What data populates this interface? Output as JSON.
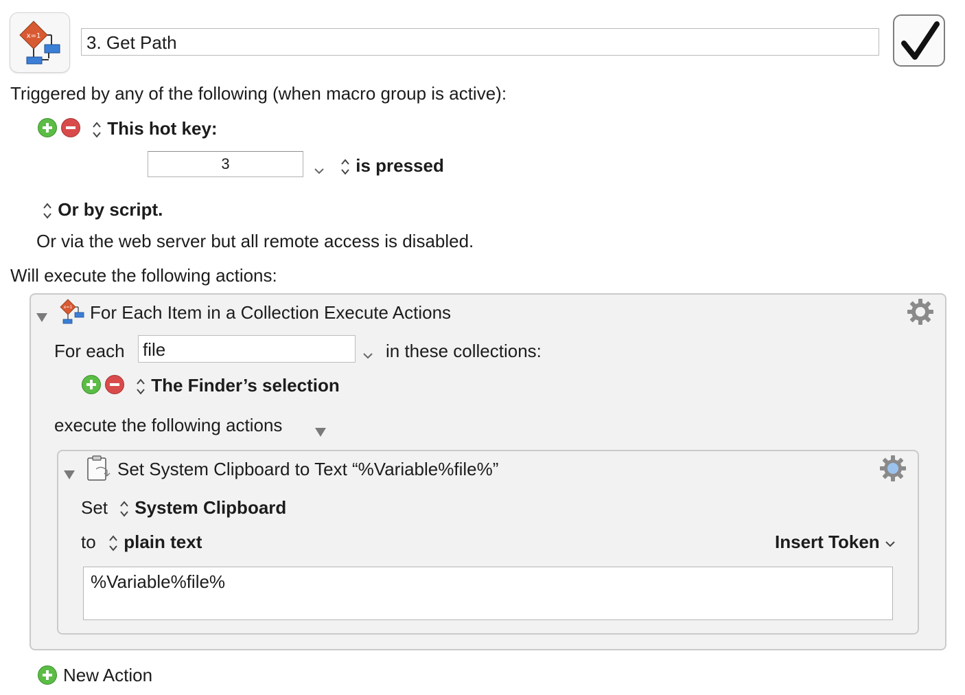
{
  "macro": {
    "name": "3. Get Path",
    "enabled": true
  },
  "triggers": {
    "heading": "Triggered by any of the following (when macro group is active):",
    "hotkey_label": "This hot key:",
    "hotkey_value": "3",
    "hotkey_condition": "is pressed",
    "script_label": "Or by script.",
    "web_server_note": "Or via the web server but all remote access is disabled."
  },
  "actions_heading": "Will execute the following actions:",
  "for_each_action": {
    "title": "For Each Item in a Collection Execute Actions",
    "for_each_label": "For each",
    "variable": "file",
    "collections_label": "in these collections:",
    "collection": "The Finder’s selection",
    "execute_label": "execute the following actions"
  },
  "clipboard_action": {
    "title": "Set System Clipboard to Text “%Variable%file%”",
    "set_label": "Set",
    "target": "System Clipboard",
    "to_label": "to",
    "format": "plain text",
    "insert_token": "Insert Token",
    "text": "%Variable%file%"
  },
  "new_action_label": "New Action",
  "icons": {
    "add": "plus-circle-icon",
    "remove": "minus-circle-icon",
    "gear": "gear-icon",
    "disclosure": "disclosure-triangle-icon",
    "clipboard": "clipboard-icon",
    "macro": "flowchart-icon"
  },
  "colors": {
    "add_green": "#5bbd45",
    "remove_red": "#d94b4b",
    "panel_bg": "#f2f2f2"
  }
}
